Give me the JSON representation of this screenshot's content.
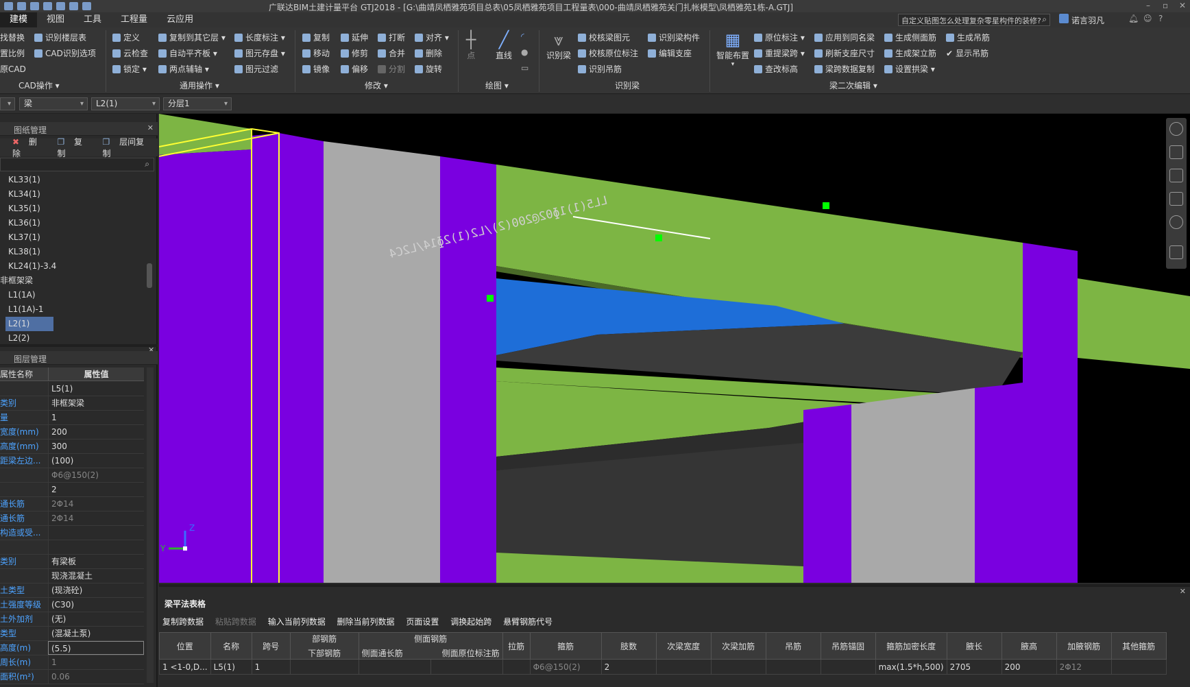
{
  "title": "广联达BIM土建计量平台 GTJ2018 - [G:\\曲靖凤栖雅苑项目总表\\05凤栖雅苑项目工程量表\\000-曲靖凤栖雅苑关门扎帐模型\\凤栖雅苑1栋-A.GTJ]",
  "menu": [
    "建模",
    "视图",
    "工具",
    "工程量",
    "云应用"
  ],
  "search": {
    "placeholder": "自定义贴图怎么处理复杂零星构件的装修?"
  },
  "user": "诺言羽凡",
  "ribbon": {
    "cad": {
      "i1": "找替换",
      "i2": "识别楼层表",
      "i3": "置比例",
      "i4": "CAD识别选项",
      "i5": "原CAD",
      "label": "CAD操作"
    },
    "general": {
      "i1": "定义",
      "i2": "复制到其它层",
      "i3": "长度标注",
      "i4": "云检查",
      "i5": "自动平齐板",
      "i6": "图元存盘",
      "i7": "锁定",
      "i8": "两点辅轴",
      "i9": "图元过滤",
      "label": "通用操作"
    },
    "modify": {
      "i1": "复制",
      "i2": "延伸",
      "i3": "打断",
      "i4": "对齐",
      "i5": "移动",
      "i6": "修剪",
      "i7": "合并",
      "i8": "删除",
      "i9": "镜像",
      "i10": "偏移",
      "i11": "分割",
      "i12": "旋转",
      "label": "修改"
    },
    "draw": {
      "i1": "点",
      "i2": "直线",
      "label": "绘图"
    },
    "recog": {
      "i0": "识别梁",
      "i1": "校核梁图元",
      "i2": "识别梁构件",
      "i3": "校核原位标注",
      "i4": "编辑支座",
      "i5": "识别吊筋",
      "label": "识别梁"
    },
    "edit2": {
      "i0": "智能布置",
      "i1": "原位标注",
      "i2": "应用到同名梁",
      "i3": "生成侧面筋",
      "i4": "生成吊筋",
      "i5": "重提梁跨",
      "i6": "刷新支座尺寸",
      "i7": "生成架立筋",
      "i8": "显示吊筋",
      "i9": "查改标高",
      "i10": "梁跨数据复制",
      "i11": "设置拱梁",
      "label": "梁二次编辑"
    }
  },
  "selectors": [
    "梁",
    "L2(1)",
    "分层1"
  ],
  "panel1": {
    "title": "图纸管理",
    "btn_delete": "删除",
    "btn_copy": "复制",
    "btn_layercopy": "层间复制"
  },
  "tree": [
    "KL33(1)",
    "KL34(1)",
    "KL35(1)",
    "KL36(1)",
    "KL37(1)",
    "KL38(1)",
    "KL24(1)-3.4",
    "非框架梁",
    "L1(1A)",
    "L1(1A)-1",
    "L2(1)",
    "L2(2)"
  ],
  "panel2": {
    "title": "图层管理",
    "col_name": "属性名称",
    "col_value": "属性值"
  },
  "props": [
    {
      "n": "",
      "v": "L5(1)"
    },
    {
      "n": "类别",
      "v": "非框架梁"
    },
    {
      "n": "量",
      "v": "1"
    },
    {
      "n": "宽度(mm)",
      "v": "200"
    },
    {
      "n": "高度(mm)",
      "v": "300"
    },
    {
      "n": "距梁左边...",
      "v": "(100)"
    },
    {
      "n": "",
      "v": "Φ6@150(2)"
    },
    {
      "n": "",
      "v": "2"
    },
    {
      "n": "通长筋",
      "v": "2Φ14"
    },
    {
      "n": "通长筋",
      "v": "2Φ14"
    },
    {
      "n": "构造或受...",
      "v": ""
    },
    {
      "n": "",
      "v": ""
    },
    {
      "n": "类别",
      "v": "有梁板"
    },
    {
      "n": "",
      "v": "现浇混凝土"
    },
    {
      "n": "土类型",
      "v": "(现浇砼)"
    },
    {
      "n": "土强度等级",
      "v": "(C30)"
    },
    {
      "n": "土外加剂",
      "v": "(无)"
    },
    {
      "n": "类型",
      "v": "(混凝土泵)"
    },
    {
      "n": "高度(m)",
      "v": "(5.5)"
    },
    {
      "n": "周长(m)",
      "v": "1"
    },
    {
      "n": "面积(m²)",
      "v": "0.06"
    }
  ],
  "bottom": {
    "title": "梁平法表格",
    "toolbar": [
      "复制跨数据",
      "粘贴跨数据",
      "输入当前列数据",
      "删除当前列数据",
      "页面设置",
      "调换起始跨",
      "悬臂钢筋代号"
    ],
    "headers": [
      "位置",
      "名称",
      "跨号",
      "部钢筋",
      "下部钢筋",
      "侧面钢筋",
      "侧面通长筋",
      "侧面原位标注筋",
      "拉筋",
      "箍筋",
      "肢数",
      "次梁宽度",
      "次梁加筋",
      "吊筋",
      "吊筋锚固",
      "箍筋加密长度",
      "腋长",
      "腋高",
      "加腋钢筋",
      "其他箍筋"
    ],
    "row": [
      "1 <1-0,D...",
      "L5(1)",
      "1",
      "",
      "",
      "",
      "",
      "",
      "Φ6@150(2)",
      "2",
      "",
      "",
      "",
      "",
      "max(1.5*h,500)",
      "2705",
      "200",
      "2Φ12",
      ""
    ]
  },
  "viewport_text": "LL5(1)1ɸ02@200(2)/L2(1)2ɸ14/L2C4",
  "axis": {
    "y": "Y",
    "z": "Z"
  }
}
